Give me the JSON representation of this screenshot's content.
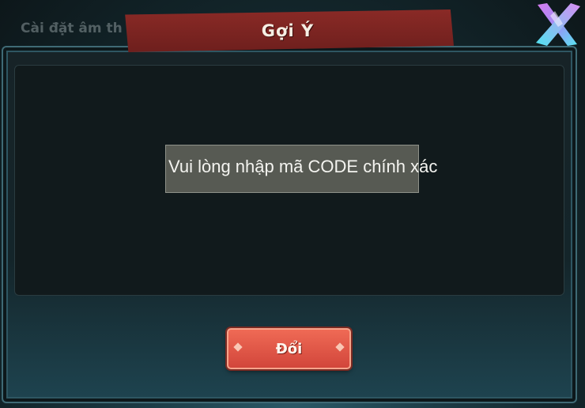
{
  "background": {
    "partial_text": "Cài đặt âm th"
  },
  "dialog": {
    "title": "Gợi Ý",
    "close_icon": "close-x-icon",
    "message": "Vui lòng nhập mã CODE chính xác",
    "action_label": "Đổi"
  },
  "colors": {
    "title_banner": "#7c2522",
    "button": "#e0574a",
    "panel_border": "#3f6a75",
    "toast_bg": "#575a53"
  }
}
